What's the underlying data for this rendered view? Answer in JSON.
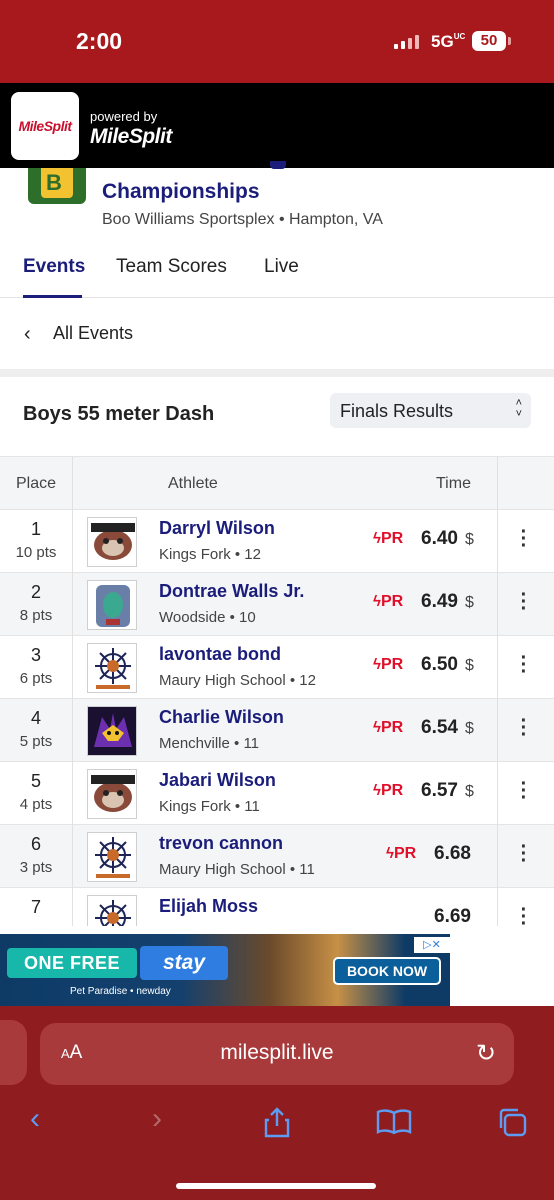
{
  "status_bar": {
    "time": "2:00",
    "network": "5G",
    "network_sup": "UC",
    "battery": "50"
  },
  "milesplit_header": {
    "logo_text": "MileSplit",
    "powered_by": "powered by",
    "brand": "MileSplit"
  },
  "meet": {
    "title": "Championships",
    "venue": "Boo Williams Sportsplex • Hampton, VA"
  },
  "tabs": [
    {
      "label": "Events"
    },
    {
      "label": "Team Scores"
    },
    {
      "label": "Live"
    }
  ],
  "nav": {
    "all_events": "All Events"
  },
  "event": {
    "title": "Boys 55 meter Dash",
    "results_select": "Finals Results"
  },
  "table": {
    "headers": {
      "place": "Place",
      "athlete": "Athlete",
      "time": "Time"
    },
    "rows": [
      {
        "place": "1",
        "points": "10 pts",
        "name": "Darryl Wilson",
        "team": "Kings Fork • 12",
        "pr": "PR",
        "mark": "6.40",
        "currency": "$",
        "logo": "bulldog-icon"
      },
      {
        "place": "2",
        "points": "8 pts",
        "name": "Dontrae Walls Jr.",
        "team": "Woodside • 10",
        "pr": "PR",
        "mark": "6.49",
        "currency": "$",
        "logo": "wolverine-icon"
      },
      {
        "place": "3",
        "points": "6 pts",
        "name": "lavontae bond",
        "team": "Maury High School • 12",
        "pr": "PR",
        "mark": "6.50",
        "currency": "$",
        "logo": "ship-wheel-icon"
      },
      {
        "place": "4",
        "points": "5 pts",
        "name": "Charlie Wilson",
        "team": "Menchville • 11",
        "pr": "PR",
        "mark": "6.54",
        "currency": "$",
        "logo": "monarch-icon"
      },
      {
        "place": "5",
        "points": "4 pts",
        "name": "Jabari Wilson",
        "team": "Kings Fork • 11",
        "pr": "PR",
        "mark": "6.57",
        "currency": "$",
        "logo": "bulldog-icon"
      },
      {
        "place": "6",
        "points": "3 pts",
        "name": "trevon cannon",
        "team": "Maury High School • 11",
        "pr": "PR",
        "mark": "6.68",
        "currency": "",
        "logo": "ship-wheel-icon"
      },
      {
        "place": "7",
        "points": "",
        "name": "Elijah Moss",
        "team": "",
        "pr": "",
        "mark": "6.69",
        "currency": "",
        "logo": "ship-wheel-icon"
      }
    ]
  },
  "ad": {
    "offer": "ONE FREE",
    "stay": "stay",
    "brand": "Pet Paradise • newday",
    "cta": "BOOK NOW"
  },
  "browser": {
    "text_size": "AA",
    "url": "milesplit.live"
  },
  "colors": {
    "brand_red": "#a8191e",
    "navy": "#1b1d7a",
    "pr_red": "#e0102b",
    "ios_blue": "#5d9cf2"
  }
}
